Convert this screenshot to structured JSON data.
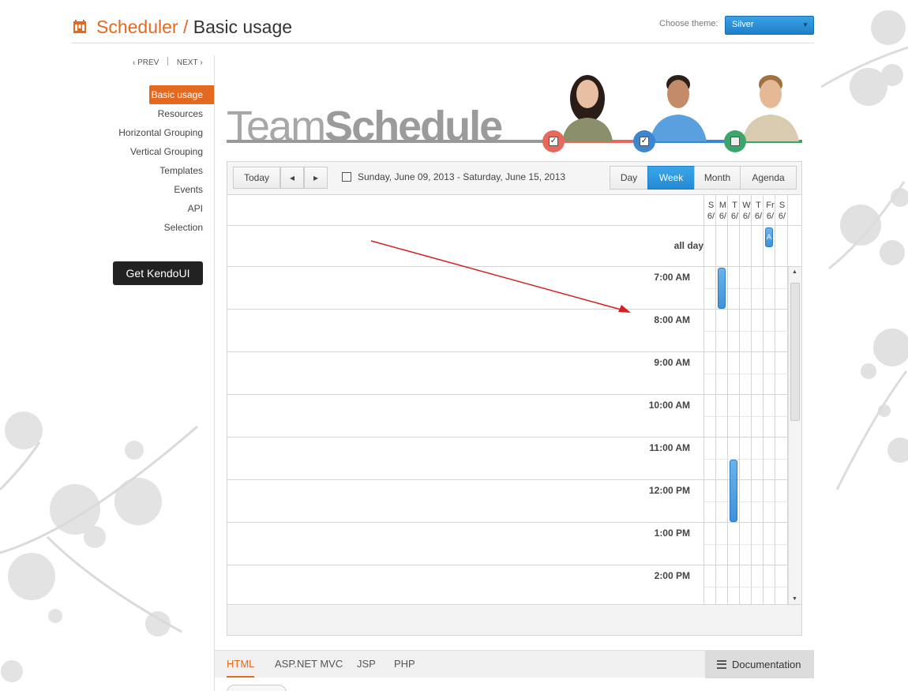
{
  "header": {
    "title_main": "Scheduler",
    "title_sep": " / ",
    "title_sub": "Basic usage",
    "theme_label": "Choose theme:",
    "theme_value": "Silver"
  },
  "pager": {
    "prev": "PREV",
    "next": "NEXT"
  },
  "sidebar": {
    "items": [
      {
        "label": "Basic usage"
      },
      {
        "label": "Resources"
      },
      {
        "label": "Horizontal Grouping"
      },
      {
        "label": "Vertical Grouping"
      },
      {
        "label": "Templates"
      },
      {
        "label": "Events"
      },
      {
        "label": "API"
      },
      {
        "label": "Selection"
      }
    ],
    "cta": "Get KendoUI"
  },
  "banner": {
    "word_light": "Team",
    "word_bold": "Schedule"
  },
  "scheduler": {
    "today": "Today",
    "prev": "◂",
    "next": "▸",
    "date_range": "Sunday, June 09, 2013 - Saturday, June 15, 2013",
    "views": [
      "Day",
      "Week",
      "Month",
      "Agenda"
    ],
    "selected_view": "Week",
    "day_headers": [
      [
        "S",
        "6/"
      ],
      [
        "M",
        "6/"
      ],
      [
        "T",
        "6/"
      ],
      [
        "W",
        "6/"
      ],
      [
        "T",
        "6/"
      ],
      [
        "Fr",
        "6/"
      ],
      [
        "S",
        "6/"
      ]
    ],
    "allday_label": "all day",
    "times": [
      "7:00 AM",
      "8:00 AM",
      "9:00 AM",
      "10:00 AM",
      "11:00 AM",
      "12:00 PM",
      "1:00 PM",
      "2:00 PM"
    ],
    "allday_event_text": "A"
  },
  "colors": {
    "accent": "#e2691f",
    "selected_view": "#2589d4",
    "person1": "#e8685a",
    "person2": "#3d86d0",
    "person3": "#3aa66a"
  },
  "tabs": {
    "items": [
      "HTML",
      "ASP.NET MVC",
      "JSP",
      "PHP"
    ],
    "active": "HTML",
    "docs": "Documentation"
  }
}
